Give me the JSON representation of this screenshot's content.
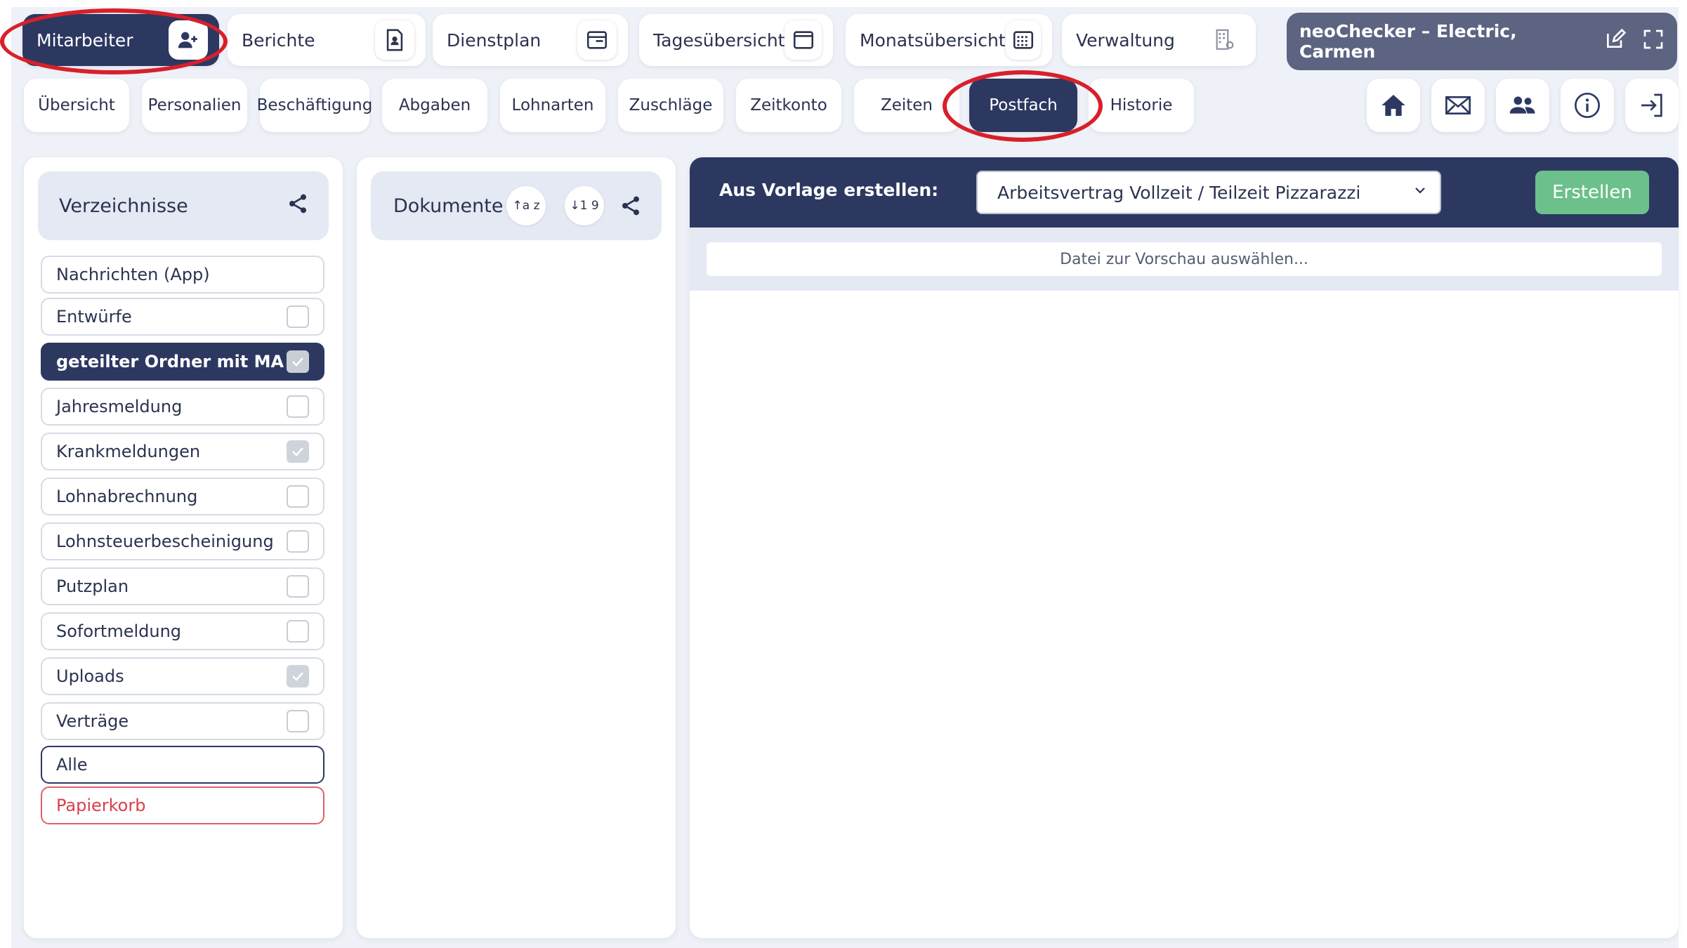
{
  "modules": [
    {
      "label": "Mitarbeiter",
      "icon": "user-plus-icon",
      "active": true
    },
    {
      "label": "Berichte",
      "icon": "report-icon"
    },
    {
      "label": "Dienstplan",
      "icon": "schedule-icon"
    },
    {
      "label": "Tagesübersicht",
      "icon": "day-view-icon"
    },
    {
      "label": "Monatsübersicht",
      "icon": "month-calendar-icon"
    },
    {
      "label": "Verwaltung",
      "icon": "building-gear-icon"
    }
  ],
  "user": {
    "name": "neoChecker – Electric, Carmen"
  },
  "subtabs": [
    "Übersicht",
    "Personalien",
    "Beschäftigung",
    "Abgaben",
    "Lohnarten",
    "Zuschläge",
    "Zeitkonto",
    "Zeiten",
    "Postfach",
    "Historie"
  ],
  "active_subtab": "Postfach",
  "right_icons": [
    "home-icon",
    "mail-icon",
    "users-icon",
    "info-icon",
    "logout-icon"
  ],
  "directories": {
    "title": "Verzeichnisse",
    "items": [
      {
        "label": "Nachrichten (App)",
        "checkbox": null
      },
      {
        "label": "Entwürfe",
        "checkbox": false
      },
      {
        "label": "geteilter Ordner mit MA",
        "checkbox": true,
        "selected": true
      },
      {
        "label": "Jahresmeldung",
        "checkbox": false
      },
      {
        "label": "Krankmeldungen",
        "checkbox": true
      },
      {
        "label": "Lohnabrechnung",
        "checkbox": false
      },
      {
        "label": "Lohnsteuerbescheinigung",
        "checkbox": false
      },
      {
        "label": "Putzplan",
        "checkbox": false
      },
      {
        "label": "Sofortmeldung",
        "checkbox": false
      },
      {
        "label": "Uploads",
        "checkbox": true
      },
      {
        "label": "Verträge",
        "checkbox": false
      }
    ],
    "all_label": "Alle",
    "trash_label": "Papierkorb"
  },
  "documents": {
    "title": "Dokumente",
    "sort_alpha": "↑a z",
    "sort_num": "↓1 9"
  },
  "preview": {
    "template_label": "Aus Vorlage erstellen:",
    "template_value": "Arbeitsvertrag Vollzeit / Teilzeit Pizzarazzi",
    "create_label": "Erstellen",
    "hint": "Datei zur Vorschau auswählen..."
  },
  "colors": {
    "primary": "#2d3861",
    "success": "#6cc08b",
    "danger": "#d8202a",
    "background": "#eef1f7"
  }
}
